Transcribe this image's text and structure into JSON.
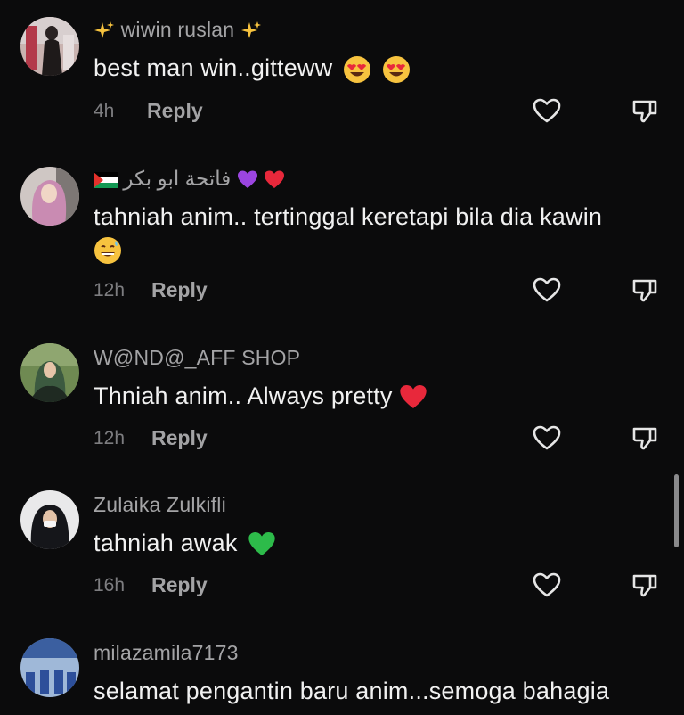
{
  "comments": [
    {
      "username": "wiwin ruslan",
      "text": "best man win..gitteww",
      "time": "4h",
      "reply_label": "Reply"
    },
    {
      "username": "فاتحة ابو بكر",
      "text": "tahniah anim.. tertinggal keretapi bila dia kawin",
      "time": "12h",
      "reply_label": "Reply"
    },
    {
      "username": "W@ND@_AFF SHOP",
      "text": "Thniah anim.. Always pretty",
      "time": "12h",
      "reply_label": "Reply"
    },
    {
      "username": "Zulaika Zulkifli",
      "text": "tahniah awak",
      "time": "16h",
      "reply_label": "Reply"
    },
    {
      "username": "milazamila7173",
      "text": "selamat pengantin baru anim...semoga bahagia"
    }
  ],
  "icons": {
    "like": "heart-outline-icon",
    "dislike": "thumbs-down-outline-icon"
  },
  "colors": {
    "background": "#0b0b0c",
    "text": "#f1f1f1",
    "username": "#a4a4a6",
    "meta": "#7d7d80"
  }
}
